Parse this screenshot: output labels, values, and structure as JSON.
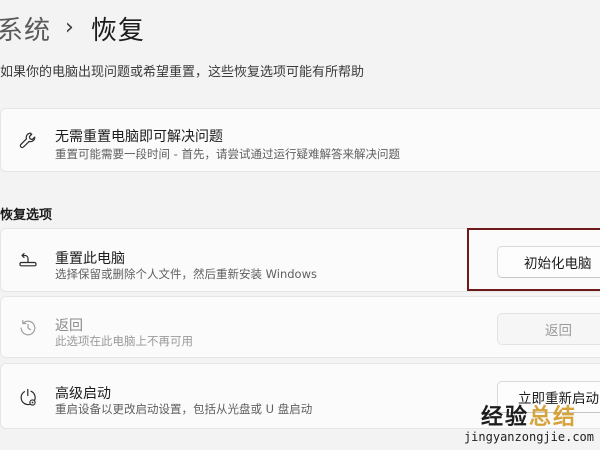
{
  "breadcrumb": {
    "parent": "系统",
    "separator": "›",
    "current": "恢复"
  },
  "subtitle": "如果你的电脑出现问题或希望重置，这些恢复选项可能有所帮助",
  "troubleshoot_card": {
    "icon": "wrench-icon",
    "title": "无需重置电脑即可解决问题",
    "description": "重置可能需要一段时间 - 首先，请尝试通过运行疑难解答来解决问题"
  },
  "section_title": "恢复选项",
  "options": [
    {
      "icon": "reset-pc-icon",
      "title": "重置此电脑",
      "description": "选择保留或删除个人文件，然后重新安装 Windows",
      "button": "初始化电脑",
      "disabled": false
    },
    {
      "icon": "history-icon",
      "title": "返回",
      "description": "此选项在此电脑上不再可用",
      "button": "返回",
      "disabled": true
    },
    {
      "icon": "advanced-startup-icon",
      "title": "高级启动",
      "description": "重启设备以更改启动设置，包括从光盘或 U 盘启动",
      "button": "立即重新启动",
      "disabled": false
    }
  ],
  "watermark": {
    "text_main": "经验",
    "text_accent": "总结",
    "url": "jingyanzongjie.com"
  },
  "colors": {
    "background": "#f3f3f3",
    "card": "#fbfbfb",
    "highlight": "#6e1a1a",
    "watermark_accent": "#d6a23a"
  }
}
